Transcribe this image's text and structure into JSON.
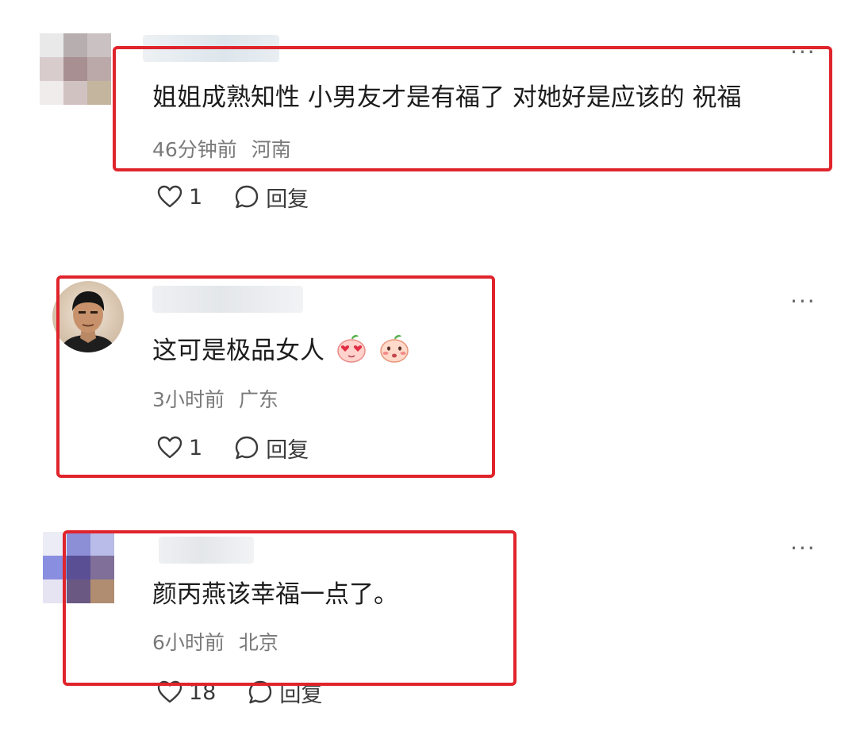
{
  "comments": [
    {
      "text": "姐姐成熟知性 小男友才是有福了 对她好是应该的 祝福",
      "time": "46分钟前",
      "location": "河南",
      "likes": "1",
      "reply_label": "回复",
      "more": "···"
    },
    {
      "text": "这可是极品女人",
      "emoji": [
        "peach-heart-eyes-emoji",
        "peach-blush-emoji"
      ],
      "time": "3小时前",
      "location": "广东",
      "likes": "1",
      "reply_label": "回复",
      "more": "···"
    },
    {
      "text": "颜丙燕该幸福一点了。",
      "time": "6小时前",
      "location": "北京",
      "likes": "18",
      "reply_label": "回复",
      "more": "···"
    }
  ],
  "colors": {
    "highlight": "#e0242c",
    "meta": "#7a7a7a",
    "text": "#1c1c1c"
  }
}
